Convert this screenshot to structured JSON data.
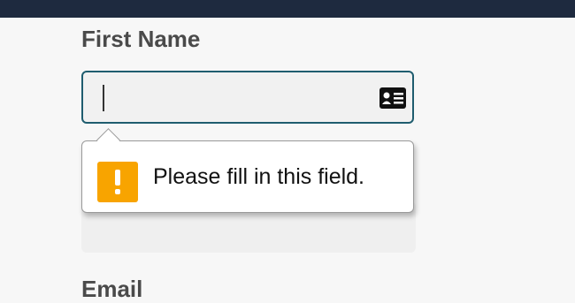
{
  "header": {
    "color": "#1e2a3f"
  },
  "form": {
    "first_name_label": "First Name",
    "first_name_value": "",
    "next_label": "Email"
  },
  "validation_tooltip": {
    "icon": "warning-icon",
    "message": "Please fill in this field."
  },
  "icons": {
    "input_autofill": "contact-card-icon"
  },
  "colors": {
    "input_focus_border": "#1f5d6f",
    "warning": "#f8a400"
  }
}
